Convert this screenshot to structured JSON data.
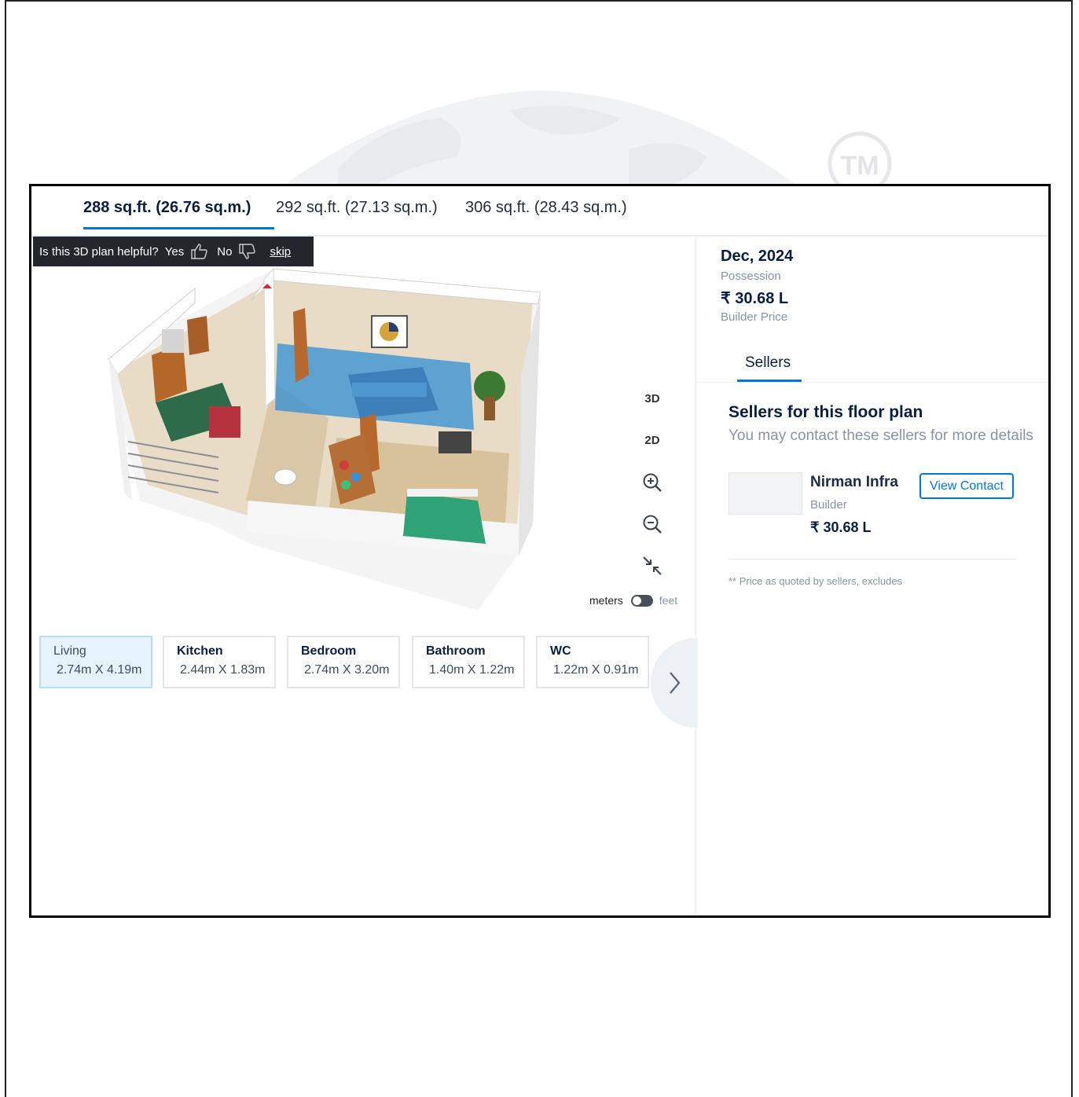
{
  "area_tabs": [
    {
      "label": "288 sq.ft. (26.76 sq.m.)",
      "active": true
    },
    {
      "label": "292 sq.ft. (27.13 sq.m.)",
      "active": false
    },
    {
      "label": "306 sq.ft. (28.43 sq.m.)",
      "active": false
    }
  ],
  "watermark": {
    "text": "TM"
  },
  "feedback": {
    "question": "Is this 3D plan helpful?",
    "yes": "Yes",
    "no": "No",
    "skip": "skip"
  },
  "view_controls": {
    "mode_3d": "3D",
    "mode_2d": "2D",
    "zoom_in_icon": "zoom-in-icon",
    "zoom_out_icon": "zoom-out-icon",
    "collapse_icon": "collapse-icon"
  },
  "units": {
    "left": "meters",
    "right": "feet"
  },
  "rooms": [
    {
      "name": "Living",
      "dims": "2.74m X 4.19m",
      "active": true
    },
    {
      "name": "Kitchen",
      "dims": "2.44m X 1.83m",
      "active": false
    },
    {
      "name": "Bedroom",
      "dims": "2.74m X 3.20m",
      "active": false
    },
    {
      "name": "Bathroom",
      "dims": "1.40m X 1.22m",
      "active": false
    },
    {
      "name": "WC",
      "dims": "1.22m X 0.91m",
      "active": false
    }
  ],
  "details": {
    "possession_date": "Dec, 2024",
    "possession_label": "Possession",
    "price": "₹ 30.68 L",
    "price_label": "Builder Price"
  },
  "sellers": {
    "tab_label": "Sellers",
    "title": "Sellers for this floor plan",
    "subtitle": "You may contact these sellers for more details",
    "list": [
      {
        "name": "Nirman Infra",
        "role": "Builder",
        "price": "₹ 30.68 L",
        "button": "View Contact"
      }
    ],
    "note": "** Price as quoted by sellers, excludes"
  },
  "colors": {
    "accent": "#0078db",
    "text": "#091e42",
    "muted": "#8993a4"
  }
}
